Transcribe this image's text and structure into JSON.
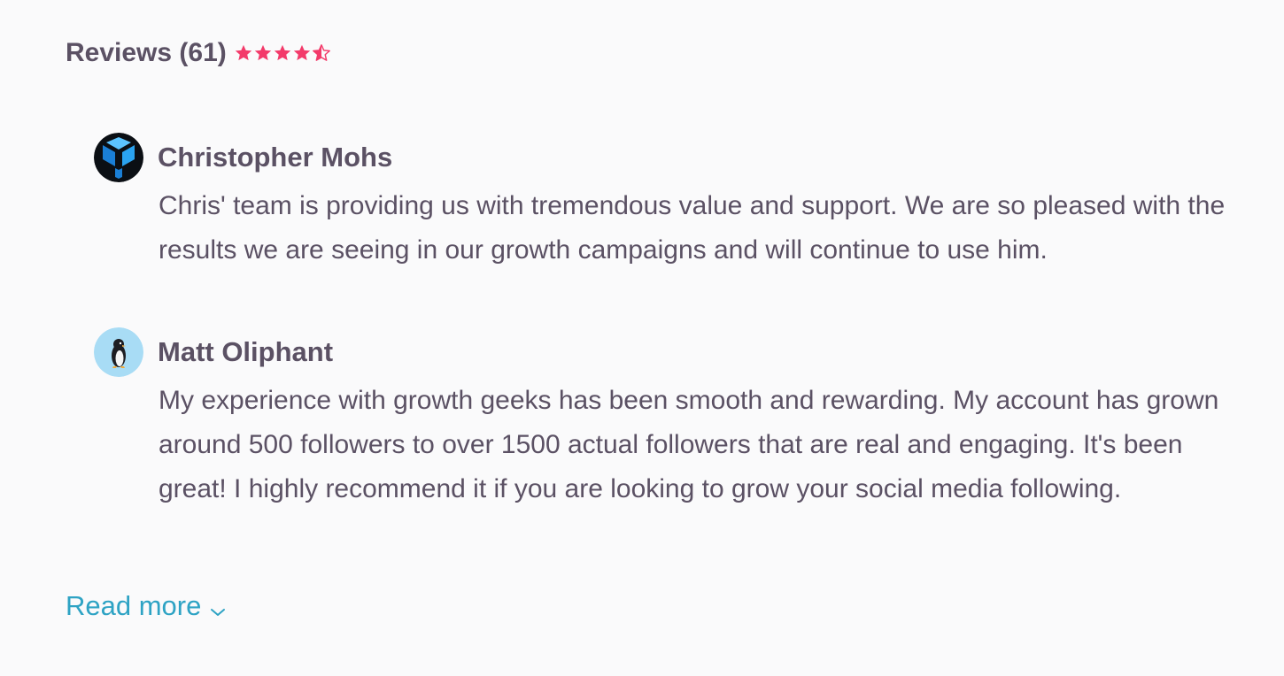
{
  "reviews_section": {
    "title": "Reviews (61)",
    "rating": 4.5,
    "rating_max": 5,
    "star_color": "#f33a6a"
  },
  "reviews": [
    {
      "name": "Christopher Mohs",
      "avatar_icon": "blue-y-logo-icon",
      "text": "Chris' team is providing us with tremendous value and support. We are so pleased with the results we are seeing in our growth campaigns and will continue to use him."
    },
    {
      "name": "Matt Oliphant",
      "avatar_icon": "penguin-icon",
      "text": "My experience with growth geeks has been smooth and rewarding. My account has grown around 500 followers to over 1500 actual followers that are real and engaging. It's been great! I highly recommend it if you are looking to grow your social media following."
    }
  ],
  "read_more": {
    "label": "Read more",
    "icon": "chevron-down-icon",
    "color": "#2ea3c4"
  }
}
